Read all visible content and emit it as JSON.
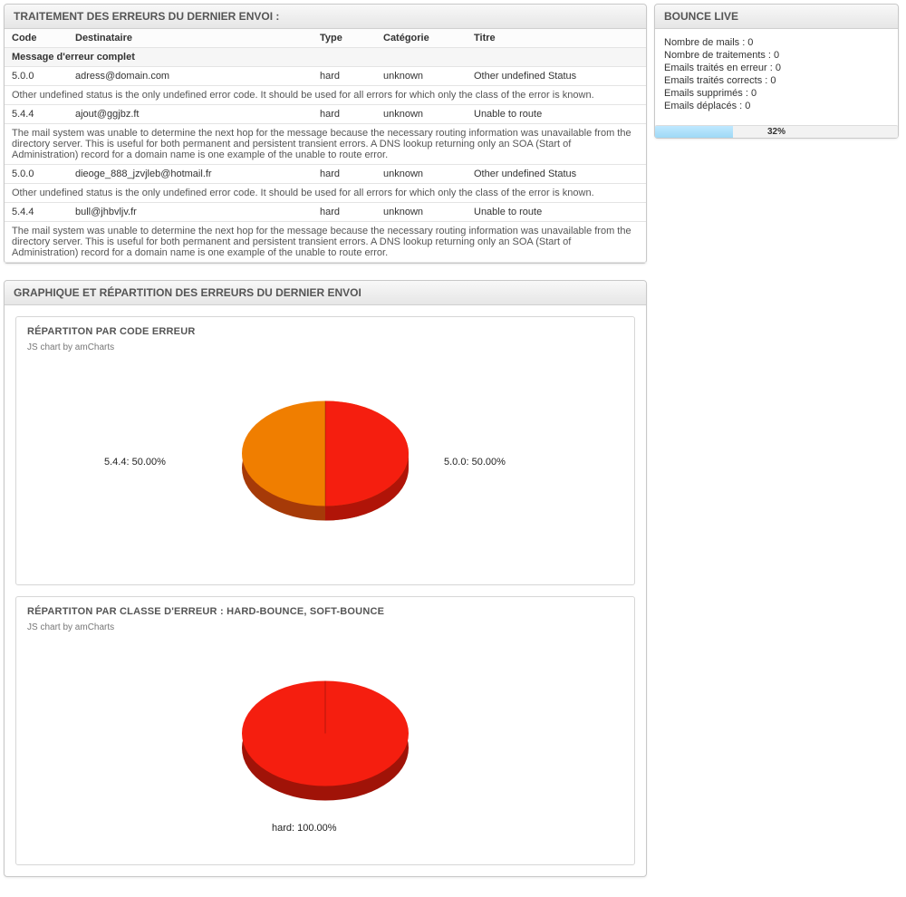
{
  "errors_panel": {
    "title": "TRAITEMENT DES ERREURS DU DERNIER ENVOI :",
    "headers": {
      "code": "Code",
      "dest": "Destinataire",
      "type": "Type",
      "cat": "Catégorie",
      "titre": "Titre"
    },
    "subheader": "Message d'erreur complet",
    "rows": [
      {
        "code": "5.0.0",
        "dest": "adress@domain.com",
        "type": "hard",
        "cat": "unknown",
        "titre": "Other undefined Status",
        "msg": "Other undefined status is the only undefined error code. It should be used for all errors for which only the class of the error is known."
      },
      {
        "code": "5.4.4",
        "dest": "ajout@ggjbz.ft",
        "type": "hard",
        "cat": "unknown",
        "titre": "Unable to route",
        "msg": "The mail system was unable to determine the next hop for the message because the necessary routing information was unavailable from the directory server. This is useful for both permanent and persistent transient errors. A DNS lookup returning only an SOA (Start of Administration) record for a domain name is one example of the unable to route error."
      },
      {
        "code": "5.0.0",
        "dest": "dieoge_888_jzvjleb@hotmail.fr",
        "type": "hard",
        "cat": "unknown",
        "titre": "Other undefined Status",
        "msg": "Other undefined status is the only undefined error code. It should be used for all errors for which only the class of the error is known."
      },
      {
        "code": "5.4.4",
        "dest": "bull@jhbvljv.fr",
        "type": "hard",
        "cat": "unknown",
        "titre": "Unable to route",
        "msg": "The mail system was unable to determine the next hop for the message because the necessary routing information was unavailable from the directory server. This is useful for both permanent and persistent transient errors. A DNS lookup returning only an SOA (Start of Administration) record for a domain name is one example of the unable to route error."
      }
    ]
  },
  "charts_panel": {
    "title": "GRAPHIQUE ET RÉPARTITION DES ERREURS DU DERNIER ENVOI",
    "credit": "JS chart by amCharts",
    "chart1_title": "RÉPARTITON PAR CODE ERREUR",
    "chart2_title": "RÉPARTITON PAR CLASSE D'ERREUR : HARD-BOUNCE, SOFT-BOUNCE"
  },
  "bounce_panel": {
    "title": "BOUNCE LIVE",
    "lines": [
      "Nombre de mails : 0",
      "Nombre de traitements : 0",
      "Emails traités en erreur : 0",
      "Emails traités corrects : 0",
      "Emails supprimés : 0",
      "Emails déplacés : 0"
    ],
    "progress_pct": 32,
    "progress_label": "32%"
  },
  "chart_data": [
    {
      "type": "pie",
      "title": "Répartiton par code erreur",
      "series": [
        {
          "name": "5.4.4",
          "value": 50.0,
          "label": "5.4.4: 50.00%",
          "color": "#f07e00"
        },
        {
          "name": "5.0.0",
          "value": 50.0,
          "label": "5.0.0: 50.00%",
          "color": "#f51e0f"
        }
      ]
    },
    {
      "type": "pie",
      "title": "Répartiton par classe d'erreur : hard-bounce, soft-bounce",
      "series": [
        {
          "name": "hard",
          "value": 100.0,
          "label": "hard: 100.00%",
          "color": "#f51e0f"
        }
      ]
    }
  ]
}
